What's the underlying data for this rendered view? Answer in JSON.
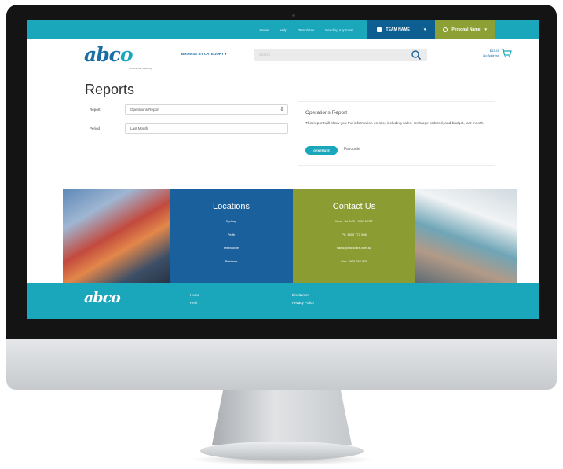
{
  "topnav": {
    "links": [
      "Home",
      "Help",
      "Templates",
      "Pending Approval"
    ],
    "team_label": "TEAM NAME",
    "personal_label": "Personal Name"
  },
  "header": {
    "logo_main": "abc",
    "logo_accent": "o",
    "logo_tagline": "Commercial Cleaning",
    "browse_label": "BROWSE BY CATEGORY",
    "search_placeholder": "Search",
    "cart_lines": [
      "$13.45",
      "No Address"
    ]
  },
  "reports": {
    "title": "Reports",
    "report_label": "Report",
    "report_value": "Operations Report",
    "period_label": "Period",
    "period_value": "Last Month"
  },
  "card": {
    "title": "Operations Report",
    "description": "This report will show you the information on site, including sales, recharge ordered, and budget, last month.",
    "button_label": "GENERATE",
    "favourite_label": "Favourite"
  },
  "locations": {
    "title": "Locations",
    "items": [
      "Sydney",
      "Perth",
      "Melbourne",
      "Brisbane"
    ]
  },
  "contact": {
    "title": "Contact Us",
    "lines": [
      "Mon - Fri 8:00 - 5:00 AEST",
      "Ph: 1800 772 006",
      "sales@abcocare.com.au",
      "Fax: 1800 652 905"
    ]
  },
  "footer": {
    "logo": "abco",
    "links_left": [
      "Home",
      "Help"
    ],
    "links_right": [
      "Disclaimer",
      "Privacy Policy"
    ]
  },
  "colors": {
    "teal": "#1aa6bb",
    "navy": "#1a609d",
    "olive": "#8b9c33",
    "team_blue": "#0d5f91",
    "personal_green": "#8da036"
  }
}
